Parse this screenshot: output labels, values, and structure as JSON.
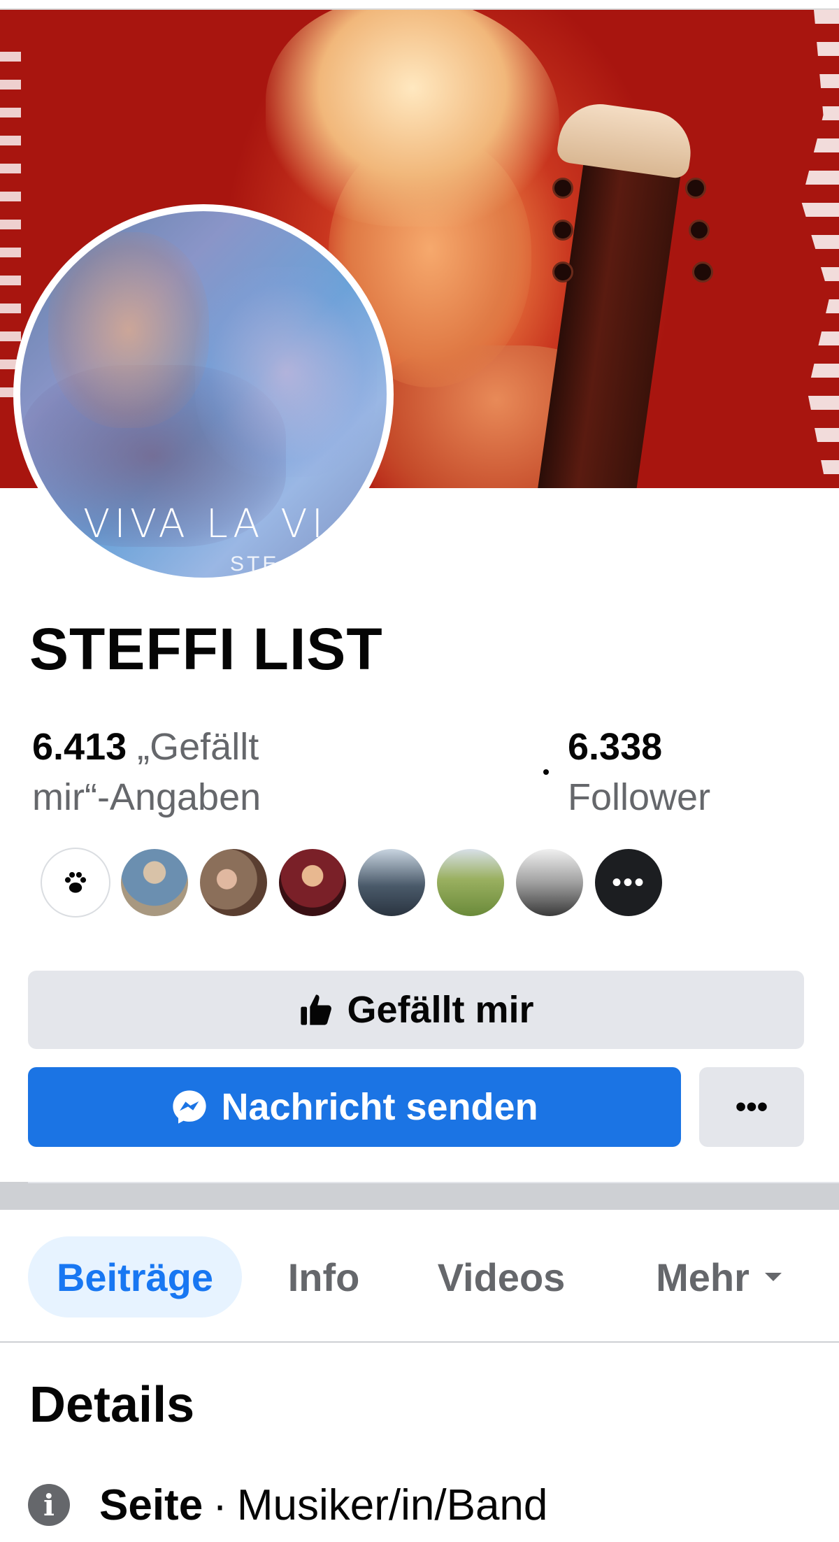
{
  "page": {
    "name": "STEFFI LIST",
    "avatar_text": "VIVA LA VI",
    "avatar_subtext": "STE"
  },
  "stats": {
    "likes_count": "6.413",
    "likes_label_line1": "„Gefällt",
    "likes_label_line2": "mir“-Angaben",
    "followers_count": "6.338",
    "followers_label": "Follower"
  },
  "friends": {
    "count_visible": 7,
    "more_label": "•••",
    "paw_icon": "paw-icon",
    "avatar_colors": [
      "#6b8fb0",
      "#8b6f5a",
      "#7a2028",
      "#4a5a6a",
      "#6a8a3a",
      "#8a8a8a"
    ]
  },
  "actions": {
    "like_label": "Gefällt mir",
    "message_label": "Nachricht senden",
    "more_label": "•••"
  },
  "tabs": [
    {
      "label": "Beiträge",
      "active": true
    },
    {
      "label": "Info",
      "active": false
    },
    {
      "label": "Videos",
      "active": false
    },
    {
      "label": "Mehr",
      "active": false
    }
  ],
  "details": {
    "title": "Details",
    "category_prefix": "Seite",
    "category_separator": "·",
    "category_value": "Musiker/in/Band",
    "info_icon_glyph": "i"
  },
  "colors": {
    "primary_blue": "#1b74e4",
    "active_tab_bg": "#e7f3ff",
    "secondary_button": "#e4e6eb",
    "text_secondary": "#65676b"
  }
}
